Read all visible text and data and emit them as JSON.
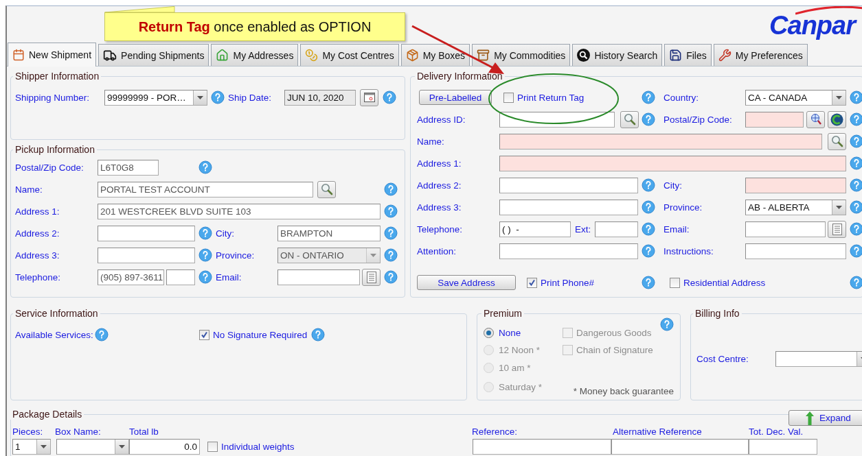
{
  "callout": {
    "emphasis": "Return Tag",
    "text": "once enabled as OPTION"
  },
  "logo": {
    "text": "Canpar"
  },
  "tabs": [
    {
      "label": "New Shipment",
      "selected": true
    },
    {
      "label": "Pending Shipments",
      "selected": false
    },
    {
      "label": "My Addresses",
      "selected": false
    },
    {
      "label": "My Cost Centres",
      "selected": false
    },
    {
      "label": "My Boxes",
      "selected": false
    },
    {
      "label": "My Commodities",
      "selected": false
    },
    {
      "label": "History Search",
      "selected": false
    },
    {
      "label": "Files",
      "selected": false
    },
    {
      "label": "My Preferences",
      "selected": false
    }
  ],
  "shipper": {
    "title": "Shipper Information",
    "shipping_number": {
      "label": "Shipping Number:",
      "value": "99999999 - POR…"
    },
    "ship_date": {
      "label": "Ship Date:",
      "value": "JUN 10, 2020"
    }
  },
  "pickup": {
    "title": "Pickup Information",
    "postal_code": {
      "label": "Postal/Zip Code:",
      "value": "L6T0G8"
    },
    "name": {
      "label": "Name:",
      "value": "PORTAL TEST ACCOUNT"
    },
    "address_1": {
      "label": "Address 1:",
      "value": "201 WESTCREEK BLVD SUITE 103"
    },
    "address_2": {
      "label": "Address 2:"
    },
    "city": {
      "label": "City:",
      "value": "BRAMPTON"
    },
    "address_3": {
      "label": "Address 3:"
    },
    "province": {
      "label": "Province:",
      "value": "ON - ONTARIO",
      "disabled": true
    },
    "telephone": {
      "label": "Telephone:",
      "value": "(905) 897-3611"
    },
    "email": {
      "label": "Email:"
    }
  },
  "delivery": {
    "title": "Delivery Information",
    "pre_labelled": "Pre-Labelled",
    "print_return_tag": {
      "label": "Print Return Tag",
      "checked": false
    },
    "country": {
      "label": "Country:",
      "value": "CA - CANADA"
    },
    "address_id": {
      "label": "Address ID:"
    },
    "postal_code": {
      "label": "Postal/Zip Code:",
      "required": true
    },
    "name": {
      "label": "Name:",
      "required": true
    },
    "address_1": {
      "label": "Address 1:",
      "required": true
    },
    "address_2": {
      "label": "Address 2:"
    },
    "city": {
      "label": "City:",
      "required": true
    },
    "address_3": {
      "label": "Address 3:"
    },
    "province": {
      "label": "Province:",
      "value": "AB - ALBERTA"
    },
    "telephone": {
      "label": "Telephone:",
      "value": "( )  -"
    },
    "ext": {
      "label": "Ext:"
    },
    "email": {
      "label": "Email:"
    },
    "attention": {
      "label": "Attention:"
    },
    "instructions": {
      "label": "Instructions:"
    },
    "save_address": "Save Address",
    "print_phone": {
      "label": "Print Phone#",
      "checked": true
    },
    "residential": {
      "label": "Residential Address",
      "checked": false
    }
  },
  "service": {
    "title": "Service Information",
    "available_services": "Available Services:",
    "no_signature": {
      "label": "No Signature Required",
      "checked": true
    }
  },
  "premium": {
    "title": "Premium",
    "options": [
      {
        "label": "None",
        "selected": true,
        "disabled": false
      },
      {
        "label": "12 Noon *",
        "selected": false,
        "disabled": true
      },
      {
        "label": "10 am *",
        "selected": false,
        "disabled": true
      },
      {
        "label": "Saturday *",
        "selected": false,
        "disabled": true
      }
    ],
    "extras": [
      {
        "label": "Dangerous Goods",
        "checked": false,
        "disabled": true
      },
      {
        "label": "Chain of Signature",
        "checked": false,
        "disabled": true
      }
    ],
    "note": "* Money back guarantee"
  },
  "billing": {
    "title": "Billing Info",
    "cost_centre": {
      "label": "Cost Centre:"
    }
  },
  "package": {
    "title": "Package Details",
    "expand": "Expand",
    "pieces": {
      "label": "Pieces:",
      "value": "1"
    },
    "box_name": {
      "label": "Box Name:"
    },
    "total": {
      "label": "Total lb",
      "value": "0.0"
    },
    "individual_weights": {
      "label": "Individual weights",
      "checked": false
    },
    "reference": "Reference:",
    "alternative_reference": "Alternative Reference",
    "declared_value": "Tot. Dec. Val."
  }
}
